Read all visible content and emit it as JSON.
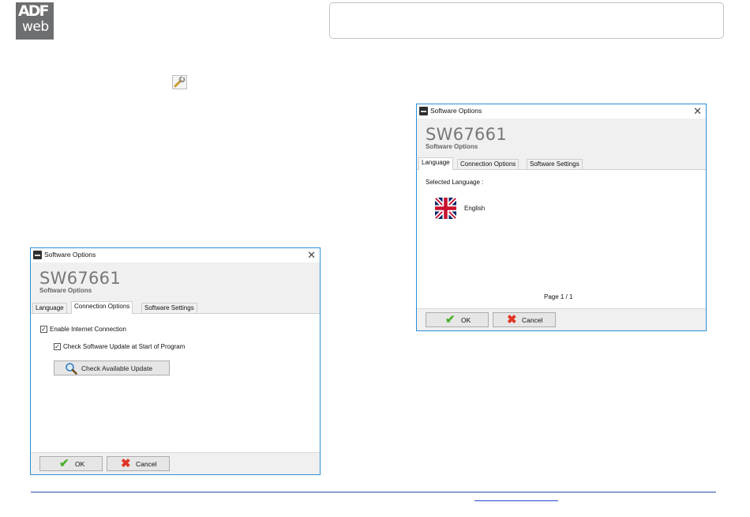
{
  "logo": {
    "line1": "ADF",
    "line2": "web"
  },
  "colors": {
    "window_border": "#2b8fd6",
    "ok_green": "#4caf2d",
    "cancel_red": "#e03424",
    "rule_blue": "#2c4aa0"
  },
  "icons": {
    "toolbar": "wrench-icon",
    "ok": "checkmark-icon",
    "cancel": "cross-icon",
    "search": "magnifier-icon",
    "language": "uk-flag-icon"
  },
  "dialog_connection": {
    "window_title": "Software Options",
    "close_glyph": "✕",
    "app_code": "SW67661",
    "subtitle": "Software Options",
    "tabs": [
      "Language",
      "Connection Options",
      "Software Settings"
    ],
    "active_tab": "Connection Options",
    "enable_internet_label": "Enable Internet Connection",
    "enable_internet_checked": true,
    "check_update_label": "Check Software Update at Start of Program",
    "check_update_checked": true,
    "check_button": "Check Available Update",
    "ok_label": "OK",
    "cancel_label": "Cancel"
  },
  "dialog_language": {
    "window_title": "Software Options",
    "close_glyph": "✕",
    "app_code": "SW67661",
    "subtitle": "Software Options",
    "tabs": [
      "Language",
      "Connection Options",
      "Software Settings"
    ],
    "active_tab": "Language",
    "selected_language_label": "Selected Language :",
    "language": "English",
    "page_indicator": "Page 1 / 1",
    "ok_label": "OK",
    "cancel_label": "Cancel"
  }
}
